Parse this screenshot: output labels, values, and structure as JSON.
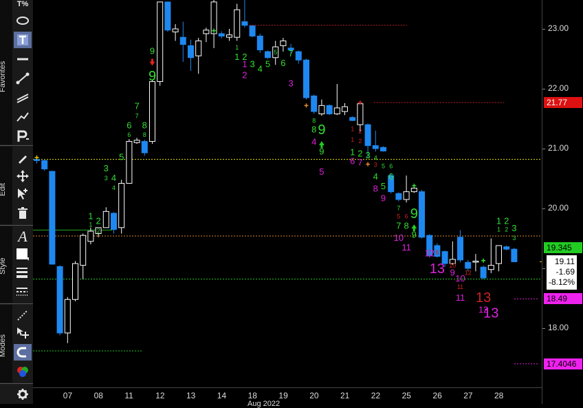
{
  "toolbar": {
    "sections": [
      "Favorites",
      "Edit",
      "Style",
      "Modes"
    ],
    "top_label": "T%"
  },
  "chart_data": {
    "type": "candlestick",
    "title": "",
    "x_tick_labels": [
      "07",
      "08",
      "11",
      "12",
      "13",
      "14",
      "18",
      "19",
      "20",
      "21",
      "22",
      "25",
      "26",
      "27",
      "28"
    ],
    "y_ticks": [
      "23.00",
      "22.00",
      "21.00",
      "20.00",
      "19.00",
      "18.00"
    ],
    "ylim": [
      17.0,
      23.5
    ],
    "bottom_label": "Aug 2022",
    "bars": [
      {
        "o": 20.82,
        "h": 20.86,
        "l": 20.75,
        "c": 20.8
      },
      {
        "o": 20.8,
        "h": 20.82,
        "l": 20.63,
        "c": 20.66
      },
      {
        "o": 20.62,
        "h": 20.63,
        "l": 19.06,
        "c": 19.07
      },
      {
        "o": 19.03,
        "h": 19.05,
        "l": 17.88,
        "c": 17.92
      },
      {
        "o": 17.92,
        "h": 18.52,
        "l": 17.75,
        "c": 18.48
      },
      {
        "o": 18.48,
        "h": 19.12,
        "l": 18.45,
        "c": 19.08
      },
      {
        "o": 19.05,
        "h": 19.58,
        "l": 18.82,
        "c": 19.55
      },
      {
        "o": 19.45,
        "h": 19.68,
        "l": 19.4,
        "c": 19.62
      },
      {
        "o": 19.58,
        "h": 19.68,
        "l": 19.52,
        "c": 19.68
      },
      {
        "o": 19.68,
        "h": 20.02,
        "l": 19.68,
        "c": 19.95
      },
      {
        "o": 19.92,
        "h": 19.94,
        "l": 19.58,
        "c": 19.65
      },
      {
        "o": 19.68,
        "h": 20.48,
        "l": 19.58,
        "c": 20.42
      },
      {
        "o": 20.42,
        "h": 21.16,
        "l": 20.42,
        "c": 21.12
      },
      {
        "o": 21.1,
        "h": 21.18,
        "l": 21.08,
        "c": 21.14
      },
      {
        "o": 21.12,
        "h": 21.15,
        "l": 20.88,
        "c": 20.93
      },
      {
        "o": 21.12,
        "h": 22.15,
        "l": 21.08,
        "c": 22.12
      },
      {
        "o": 22.12,
        "h": 23.45,
        "l": 22.05,
        "c": 23.45
      },
      {
        "o": 23.45,
        "h": 23.45,
        "l": 22.95,
        "c": 22.98
      },
      {
        "o": 22.95,
        "h": 23.08,
        "l": 22.8,
        "c": 23.0
      },
      {
        "o": 22.86,
        "h": 23.12,
        "l": 22.45,
        "c": 22.74
      },
      {
        "o": 22.72,
        "h": 22.82,
        "l": 22.3,
        "c": 22.52
      },
      {
        "o": 22.55,
        "h": 22.85,
        "l": 22.25,
        "c": 22.8
      },
      {
        "o": 22.92,
        "h": 23.02,
        "l": 22.78,
        "c": 22.98
      },
      {
        "o": 22.92,
        "h": 23.5,
        "l": 22.68,
        "c": 23.45
      },
      {
        "o": 22.92,
        "h": 22.96,
        "l": 22.84,
        "c": 22.88
      },
      {
        "o": 22.86,
        "h": 23.0,
        "l": 22.8,
        "c": 22.9
      },
      {
        "o": 22.86,
        "h": 23.42,
        "l": 22.8,
        "c": 23.32
      },
      {
        "o": 23.12,
        "h": 23.5,
        "l": 23.02,
        "c": 23.06
      },
      {
        "o": 23.05,
        "h": 23.06,
        "l": 22.86,
        "c": 22.88
      },
      {
        "o": 22.88,
        "h": 22.92,
        "l": 22.6,
        "c": 22.65
      },
      {
        "o": 22.62,
        "h": 22.64,
        "l": 22.5,
        "c": 22.52
      },
      {
        "o": 22.52,
        "h": 22.8,
        "l": 22.4,
        "c": 22.7
      },
      {
        "o": 22.72,
        "h": 22.85,
        "l": 22.62,
        "c": 22.8
      },
      {
        "o": 22.68,
        "h": 22.75,
        "l": 22.58,
        "c": 22.65
      },
      {
        "o": 22.62,
        "h": 22.64,
        "l": 22.42,
        "c": 22.48
      },
      {
        "o": 22.48,
        "h": 22.5,
        "l": 21.82,
        "c": 21.85
      },
      {
        "o": 21.88,
        "h": 21.9,
        "l": 21.58,
        "c": 21.62
      },
      {
        "o": 21.58,
        "h": 21.82,
        "l": 21.55,
        "c": 21.72
      },
      {
        "o": 21.72,
        "h": 21.74,
        "l": 21.56,
        "c": 21.58
      },
      {
        "o": 21.58,
        "h": 22.08,
        "l": 21.56,
        "c": 21.68
      },
      {
        "o": 21.62,
        "h": 21.76,
        "l": 21.56,
        "c": 21.7
      },
      {
        "o": 21.52,
        "h": 21.54,
        "l": 21.46,
        "c": 21.47
      },
      {
        "o": 21.4,
        "h": 21.78,
        "l": 21.28,
        "c": 21.75
      },
      {
        "o": 21.4,
        "h": 21.42,
        "l": 20.85,
        "c": 21.05
      },
      {
        "o": 21.05,
        "h": 21.3,
        "l": 20.95,
        "c": 21.0
      },
      {
        "o": 21.02,
        "h": 21.04,
        "l": 20.95,
        "c": 20.96
      },
      {
        "o": 20.55,
        "h": 20.58,
        "l": 20.25,
        "c": 20.28
      },
      {
        "o": 20.25,
        "h": 20.27,
        "l": 20.12,
        "c": 20.15
      },
      {
        "o": 20.15,
        "h": 20.55,
        "l": 20.1,
        "c": 20.28
      },
      {
        "o": 20.28,
        "h": 20.38,
        "l": 20.26,
        "c": 20.34
      },
      {
        "o": 20.28,
        "h": 20.31,
        "l": 19.5,
        "c": 19.52
      },
      {
        "o": 19.55,
        "h": 19.57,
        "l": 19.18,
        "c": 19.22
      },
      {
        "o": 19.38,
        "h": 19.42,
        "l": 19.18,
        "c": 19.2
      },
      {
        "o": 19.28,
        "h": 19.3,
        "l": 19.02,
        "c": 19.08
      },
      {
        "o": 19.08,
        "h": 19.45,
        "l": 19.06,
        "c": 19.15
      },
      {
        "o": 19.52,
        "h": 19.64,
        "l": 19.1,
        "c": 19.14
      },
      {
        "o": 19.1,
        "h": 19.14,
        "l": 18.95,
        "c": 19.0
      },
      {
        "o": 19.12,
        "h": 19.24,
        "l": 18.95,
        "c": 19.12
      },
      {
        "o": 19.02,
        "h": 19.05,
        "l": 18.82,
        "c": 18.84
      },
      {
        "o": 18.98,
        "h": 19.5,
        "l": 18.92,
        "c": 19.05
      },
      {
        "o": 19.08,
        "h": 19.38,
        "l": 18.95,
        "c": 19.38
      },
      {
        "o": 19.36,
        "h": 19.38,
        "l": 19.3,
        "c": 19.32
      },
      {
        "o": 19.32,
        "h": 19.34,
        "l": 19.11,
        "c": 19.11
      }
    ],
    "levels": [
      {
        "price": 20.82,
        "style": "dotted",
        "color": "#e6e600"
      },
      {
        "price": 19.54,
        "style": "dotted",
        "color": "#e08a2a"
      },
      {
        "price": 19.64,
        "style": "solid",
        "color": "#22aa22",
        "x_end_frac": 0.156
      },
      {
        "price": 18.82,
        "style": "dotted",
        "color": "#22cc22"
      },
      {
        "price": 17.62,
        "style": "dotted",
        "color": "#22cc22",
        "x_end_frac": 0.216
      },
      {
        "price": 23.06,
        "style": "dotted",
        "color": "#cc2222",
        "x_start_frac": 0.42,
        "x_end_frac": 0.735
      },
      {
        "price": 21.77,
        "style": "dotted",
        "color": "#cc2222",
        "x_start_frac": 0.67,
        "x_end_frac": 0.926
      },
      {
        "price": 18.49,
        "style": "dotted",
        "color": "#dd22dd",
        "x_start_frac": 0.946,
        "x_end_frac": 0.993
      },
      {
        "price": 17.4046,
        "style": "dotted",
        "color": "#dd22dd",
        "x_start_frac": 0.946,
        "x_end_frac": 0.993
      },
      {
        "price": 19.11,
        "style": "solid",
        "color": "#e6c200",
        "x_start_frac": 0.996,
        "x_end_frac": 1.0
      }
    ],
    "seq_counts": [
      {
        "bar": 7,
        "price": 19.86,
        "text": "1",
        "color": "#33dd33",
        "size": 13
      },
      {
        "bar": 7,
        "price": 19.72,
        "text": "1",
        "color": "#33dd33",
        "size": 9
      },
      {
        "bar": 8,
        "price": 19.78,
        "text": "2",
        "color": "#33dd33",
        "size": 13
      },
      {
        "bar": 8,
        "price": 19.62,
        "text": "2",
        "color": "#33dd33",
        "size": 9
      },
      {
        "bar": 9,
        "price": 20.66,
        "text": "3",
        "color": "#33dd33",
        "size": 13
      },
      {
        "bar": 9,
        "price": 20.5,
        "text": "3",
        "color": "#33dd33",
        "size": 9
      },
      {
        "bar": 10,
        "price": 20.5,
        "text": "4",
        "color": "#33dd33",
        "size": 13
      },
      {
        "bar": 10,
        "price": 20.34,
        "text": "4",
        "color": "#33dd33",
        "size": 9
      },
      {
        "bar": 11,
        "price": 20.85,
        "text": "5",
        "color": "#33dd33",
        "size": 13
      },
      {
        "bar": 12,
        "price": 21.38,
        "text": "6",
        "color": "#33dd33",
        "size": 13
      },
      {
        "bar": 12,
        "price": 21.22,
        "text": "6",
        "color": "#33dd33",
        "size": 9
      },
      {
        "bar": 13,
        "price": 21.7,
        "text": "7",
        "color": "#33dd33",
        "size": 13
      },
      {
        "bar": 13,
        "price": 21.54,
        "text": "7",
        "color": "#33dd33",
        "size": 9
      },
      {
        "bar": 14,
        "price": 21.38,
        "text": "8",
        "color": "#33dd33",
        "size": 13
      },
      {
        "bar": 14,
        "price": 21.22,
        "text": "8",
        "color": "#33dd33",
        "size": 9
      },
      {
        "bar": 15,
        "price": 22.62,
        "text": "9",
        "color": "#33dd33",
        "size": 13
      },
      {
        "bar": 15,
        "price": 22.2,
        "text": "9",
        "color": "#33dd33",
        "size": 20
      },
      {
        "bar": 26,
        "price": 22.68,
        "text": "1",
        "color": "#33dd33",
        "size": 9
      },
      {
        "bar": 26,
        "price": 22.52,
        "text": "1",
        "color": "#33dd33",
        "size": 13
      },
      {
        "bar": 27,
        "price": 22.52,
        "text": "2",
        "color": "#33dd33",
        "size": 13
      },
      {
        "bar": 28,
        "price": 22.4,
        "text": "3",
        "color": "#33dd33",
        "size": 13
      },
      {
        "bar": 29,
        "price": 22.32,
        "text": "4",
        "color": "#33dd33",
        "size": 13
      },
      {
        "bar": 30,
        "price": 22.4,
        "text": "5",
        "color": "#33dd33",
        "size": 13
      },
      {
        "bar": 31,
        "price": 22.6,
        "text": "5",
        "color": "#33dd33",
        "size": 9
      },
      {
        "bar": 32,
        "price": 22.42,
        "text": "6",
        "color": "#33dd33",
        "size": 13
      },
      {
        "bar": 33,
        "price": 22.58,
        "text": "7",
        "color": "#33dd33",
        "size": 13
      },
      {
        "bar": 27,
        "price": 22.22,
        "text": "2",
        "color": "#dd22dd",
        "size": 13
      },
      {
        "bar": 27,
        "price": 22.4,
        "text": "1",
        "color": "#dd22dd",
        "size": 13
      },
      {
        "bar": 33,
        "price": 22.08,
        "text": "3",
        "color": "#dd22dd",
        "size": 13
      },
      {
        "bar": 36,
        "price": 21.46,
        "text": "8",
        "color": "#33dd33",
        "size": 9
      },
      {
        "bar": 36,
        "price": 21.31,
        "text": "8",
        "color": "#33dd33",
        "size": 13
      },
      {
        "bar": 37,
        "price": 21.3,
        "text": "9",
        "color": "#33dd33",
        "size": 20
      },
      {
        "bar": 37,
        "price": 20.94,
        "text": "9",
        "color": "#33dd33",
        "size": 13
      },
      {
        "bar": 36,
        "price": 21.1,
        "text": "4",
        "color": "#dd22dd",
        "size": 13
      },
      {
        "bar": 37,
        "price": 20.6,
        "text": "5",
        "color": "#dd22dd",
        "size": 13
      },
      {
        "bar": 41,
        "price": 21.32,
        "text": "1",
        "color": "#cc2222",
        "size": 9
      },
      {
        "bar": 41,
        "price": 21.14,
        "text": "1",
        "color": "#cc2222",
        "size": 9
      },
      {
        "bar": 42,
        "price": 21.28,
        "text": "2",
        "color": "#cc2222",
        "size": 9
      },
      {
        "bar": 42,
        "price": 21.12,
        "text": "2",
        "color": "#cc2222",
        "size": 9
      },
      {
        "bar": 41,
        "price": 20.93,
        "text": "1",
        "color": "#33dd33",
        "size": 13
      },
      {
        "bar": 42,
        "price": 20.91,
        "text": "2",
        "color": "#33dd33",
        "size": 13
      },
      {
        "bar": 43,
        "price": 20.88,
        "text": "3",
        "color": "#33dd33",
        "size": 13
      },
      {
        "bar": 41,
        "price": 20.78,
        "text": "6",
        "color": "#dd22dd",
        "size": 13
      },
      {
        "bar": 42,
        "price": 20.76,
        "text": "7",
        "color": "#dd22dd",
        "size": 13
      },
      {
        "bar": 44,
        "price": 20.84,
        "text": "4",
        "color": "#33dd33",
        "size": 9
      },
      {
        "bar": 44,
        "price": 20.72,
        "text": "3",
        "color": "#cc2222",
        "size": 9
      },
      {
        "bar": 44,
        "price": 20.52,
        "text": "4",
        "color": "#33dd33",
        "size": 13
      },
      {
        "bar": 45,
        "price": 20.7,
        "text": "5",
        "color": "#33dd33",
        "size": 9
      },
      {
        "bar": 45,
        "price": 20.36,
        "text": "5",
        "color": "#33dd33",
        "size": 13
      },
      {
        "bar": 46,
        "price": 20.7,
        "text": "6",
        "color": "#33dd33",
        "size": 9
      },
      {
        "bar": 46,
        "price": 20.52,
        "text": "6",
        "color": "#33dd33",
        "size": 13
      },
      {
        "bar": 44,
        "price": 20.32,
        "text": "8",
        "color": "#dd22dd",
        "size": 13
      },
      {
        "bar": 45,
        "price": 20.16,
        "text": "9",
        "color": "#dd22dd",
        "size": 13
      },
      {
        "bar": 47,
        "price": 20.0,
        "text": "7",
        "color": "#33dd33",
        "size": 9
      },
      {
        "bar": 47,
        "price": 19.86,
        "text": "5",
        "color": "#cc2222",
        "size": 9
      },
      {
        "bar": 48,
        "price": 19.86,
        "text": "6",
        "color": "#cc2222",
        "size": 9
      },
      {
        "bar": 47,
        "price": 19.7,
        "text": "7",
        "color": "#33dd33",
        "size": 13
      },
      {
        "bar": 48,
        "price": 19.7,
        "text": "8",
        "color": "#33dd33",
        "size": 13
      },
      {
        "bar": 49,
        "price": 19.9,
        "text": "9",
        "color": "#33dd33",
        "size": 20
      },
      {
        "bar": 49,
        "price": 19.55,
        "text": "9",
        "color": "#33dd33",
        "size": 13
      },
      {
        "bar": 47,
        "price": 19.5,
        "text": "10",
        "color": "#dd22dd",
        "size": 13
      },
      {
        "bar": 48,
        "price": 19.34,
        "text": "11",
        "color": "#dd22dd",
        "size": 13
      },
      {
        "bar": 51,
        "price": 19.26,
        "text": "7",
        "color": "#cc2222",
        "size": 9
      },
      {
        "bar": 52,
        "price": 19.26,
        "text": "8",
        "color": "#cc2222",
        "size": 9
      },
      {
        "bar": 51,
        "price": 19.24,
        "text": "12",
        "color": "#dd22dd",
        "size": 13
      },
      {
        "bar": 52,
        "price": 18.98,
        "text": "13",
        "color": "#dd22dd",
        "size": 20
      },
      {
        "bar": 54,
        "price": 18.92,
        "text": "9",
        "color": "#dd22dd",
        "size": 13
      },
      {
        "bar": 54,
        "price": 19.04,
        "text": "10",
        "color": "#cc2222",
        "size": 9
      },
      {
        "bar": 55,
        "price": 18.82,
        "text": "10",
        "color": "#dd22dd",
        "size": 13
      },
      {
        "bar": 56,
        "price": 18.92,
        "text": "12",
        "color": "#cc2222",
        "size": 9
      },
      {
        "bar": 55,
        "price": 18.68,
        "text": "11",
        "color": "#cc2222",
        "size": 9
      },
      {
        "bar": 55,
        "price": 18.5,
        "text": "11",
        "color": "#dd22dd",
        "size": 13
      },
      {
        "bar": 58,
        "price": 18.5,
        "text": "13",
        "color": "#cc2222",
        "size": 20
      },
      {
        "bar": 58,
        "price": 18.3,
        "text": "12",
        "color": "#dd22dd",
        "size": 13
      },
      {
        "bar": 59,
        "price": 18.24,
        "text": "13",
        "color": "#dd22dd",
        "size": 20
      },
      {
        "bar": 60,
        "price": 19.78,
        "text": "1",
        "color": "#33dd33",
        "size": 13
      },
      {
        "bar": 61,
        "price": 19.78,
        "text": "2",
        "color": "#33dd33",
        "size": 13
      },
      {
        "bar": 60,
        "price": 19.64,
        "text": "1",
        "color": "#33dd33",
        "size": 9
      },
      {
        "bar": 61,
        "price": 19.64,
        "text": "2",
        "color": "#33dd33",
        "size": 9
      },
      {
        "bar": 62,
        "price": 19.66,
        "text": "3",
        "color": "#33dd33",
        "size": 13
      },
      {
        "bar": 62,
        "price": 19.5,
        "text": "3",
        "color": "#33dd33",
        "size": 9
      }
    ],
    "arrows": [
      {
        "bar": 15,
        "price": 22.42,
        "dir": "down",
        "color": "#dd2222"
      },
      {
        "bar": 37,
        "price": 21.09,
        "dir": "up",
        "color": "#22cc22"
      },
      {
        "bar": 49,
        "price": 19.7,
        "dir": "up",
        "color": "#22cc22"
      }
    ],
    "plus_marks": [
      {
        "bar": 0,
        "price": 20.85,
        "color": "#e6c200"
      },
      {
        "bar": 23,
        "price": 22.97,
        "color": "#33dd33"
      },
      {
        "bar": 35,
        "price": 21.72,
        "color": "#e08a2a"
      },
      {
        "bar": 42,
        "price": 21.77,
        "color": "#cc2222"
      },
      {
        "bar": 43,
        "price": 20.74,
        "color": "#e08a2a"
      },
      {
        "bar": 49,
        "price": 20.38,
        "color": "#33dd33"
      },
      {
        "bar": 58,
        "price": 19.13,
        "color": "#33dd33"
      }
    ],
    "price_badges": [
      {
        "price": "21.77",
        "value": 21.77,
        "bg": "#dd1111",
        "fg": "#ffffff"
      },
      {
        "price": "19.345",
        "value": 19.345,
        "bg": "#22cc22",
        "fg": "#000000"
      },
      {
        "price": "18.49",
        "value": 18.49,
        "bg": "#ee22ee",
        "fg": "#000000"
      },
      {
        "price": "17.4046",
        "value": 17.4046,
        "bg": "#ee22ee",
        "fg": "#000000"
      }
    ],
    "info_box": {
      "last": "19.11",
      "change": "-1.69",
      "percent": "-8.12%"
    },
    "colors": {
      "up": "#ffffff",
      "down": "#1e88f0",
      "background": "#000000"
    }
  }
}
